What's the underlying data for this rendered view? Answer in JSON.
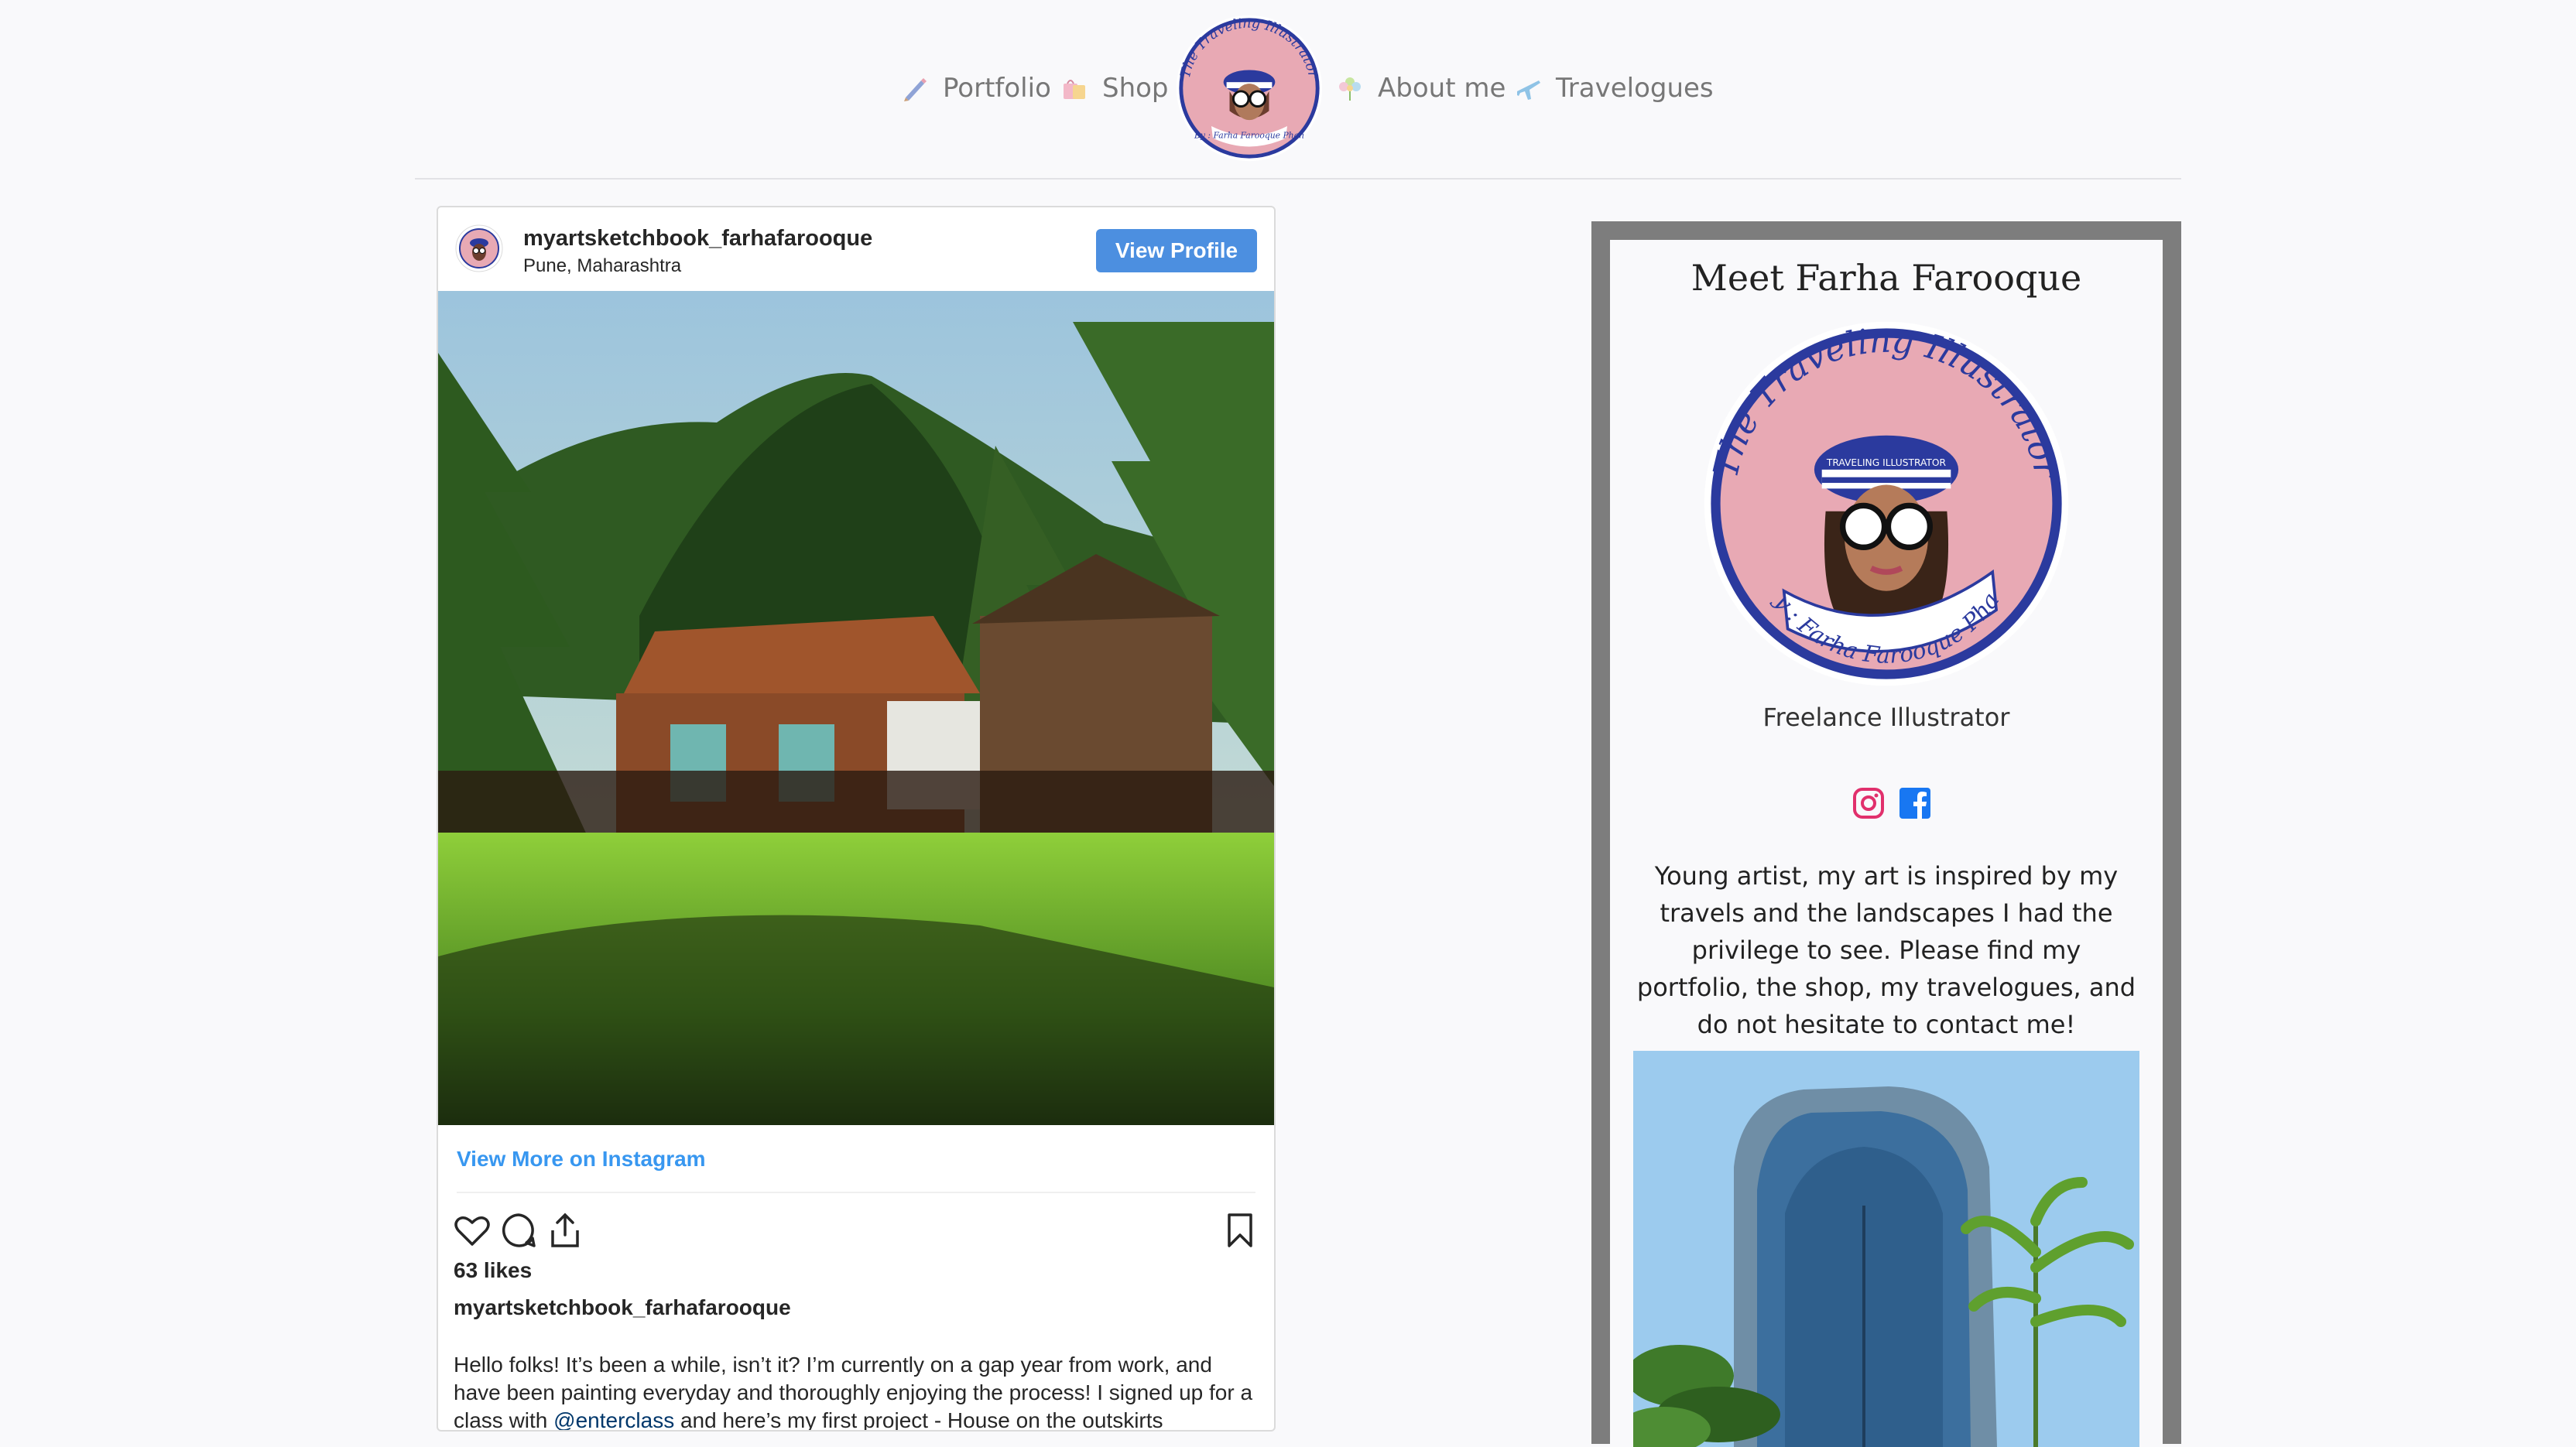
{
  "nav": {
    "items": [
      {
        "label": "Portfolio",
        "icon": "pencil-icon"
      },
      {
        "label": "Shop",
        "icon": "shopping-bags-icon"
      },
      {
        "label": "About me",
        "icon": "flower-icon"
      },
      {
        "label": "Travelogues",
        "icon": "airplane-icon"
      }
    ],
    "logo": {
      "arc_text": "The Traveling Illustrator",
      "byline": "By : Farha Farooque Phan",
      "cap_text": "TRAVELING ILLUSTRATOR"
    }
  },
  "instagram": {
    "username": "myartsketchbook_farhafarooque",
    "location": "Pune, Maharashtra",
    "view_profile_label": "View Profile",
    "view_more_label": "View More on Instagram",
    "likes": "63 likes",
    "caption_owner": "myartsketchbook_farhafarooque",
    "caption_before": "Hello folks! It’s been a while, isn’t it? I’m currently on a gap year from work, and have been painting everyday and thoroughly enjoying the process! I signed up for a class with ",
    "caption_mention": "@enterclass",
    "caption_after": " and here’s my first project - House on the outskirts"
  },
  "sidebar": {
    "title": "Meet Farha Farooque",
    "role": "Freelance Illustrator",
    "bio": "Young artist, my art is inspired by my travels and the landscapes I had the privilege to see. Please find my portfolio, the shop, my travelogues, and do not hesitate to contact me!",
    "social": [
      "instagram-icon",
      "facebook-icon"
    ]
  },
  "colors": {
    "button_blue": "#4c8fe0",
    "link_blue": "#3897f0",
    "sidebar_frame": "#7d7d7d",
    "logo_pink": "#e8a9b4",
    "logo_navy": "#2b3a9e",
    "instagram_red": "#e1306c",
    "facebook_blue": "#1877f2"
  }
}
